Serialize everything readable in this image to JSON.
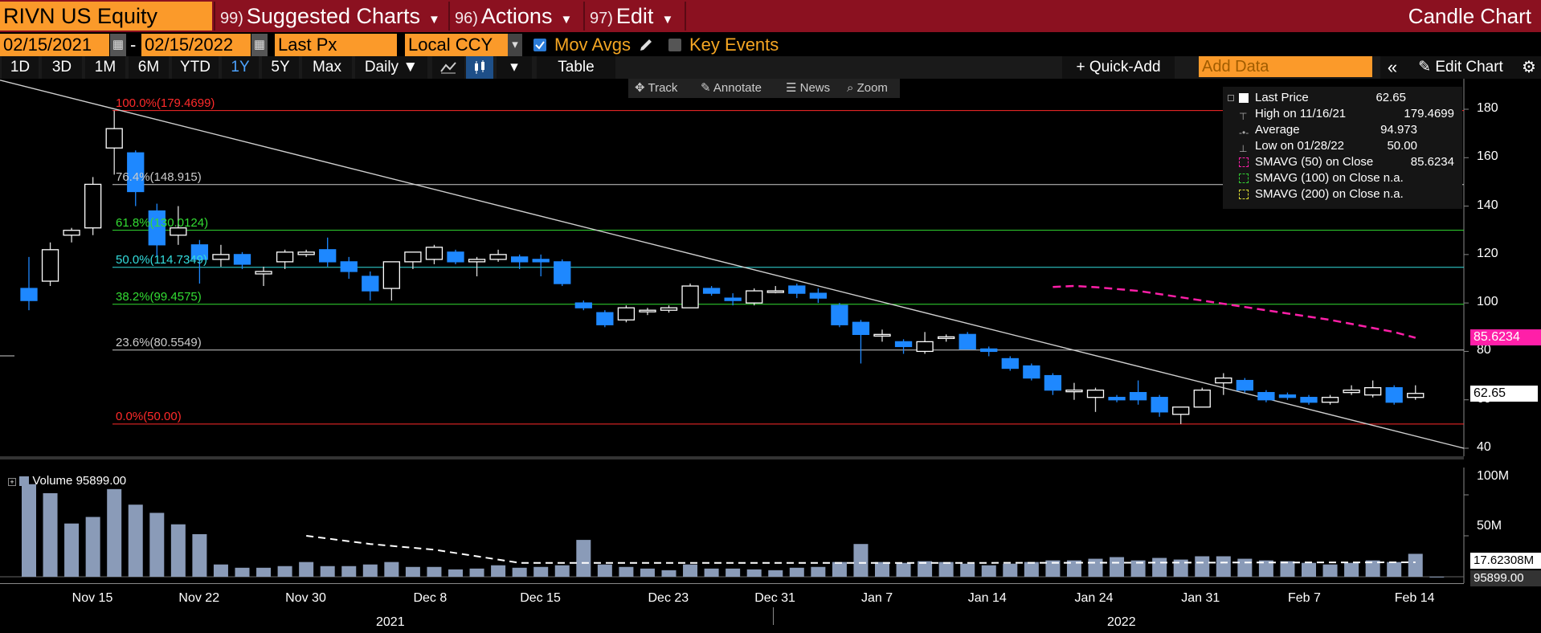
{
  "header": {
    "ticker": "RIVN US Equity",
    "menus": [
      {
        "num": "99)",
        "label": "Suggested Charts"
      },
      {
        "num": "96)",
        "label": "Actions"
      },
      {
        "num": "97)",
        "label": "Edit"
      }
    ],
    "title": "Candle Chart"
  },
  "params": {
    "start_date": "02/15/2021",
    "end_date": "02/15/2022",
    "dash": "-",
    "field": "Last Px",
    "currency": "Local CCY",
    "mov_avgs_label": "Mov Avgs",
    "key_events_label": "Key Events"
  },
  "toolbar": {
    "ranges": [
      "1D",
      "3D",
      "1M",
      "6M",
      "YTD",
      "1Y",
      "5Y",
      "Max"
    ],
    "active_range": "1Y",
    "frequency": "Daily",
    "table_label": "Table",
    "quick_add_label": "+ Quick-Add",
    "add_data_placeholder": "Add Data",
    "edit_chart_label": "Edit Chart"
  },
  "chart_tools": {
    "track": "Track",
    "annotate": "Annotate",
    "news": "News",
    "zoom": "Zoom"
  },
  "legend": {
    "last_price": {
      "label": "Last Price",
      "value": "62.65"
    },
    "high": {
      "label": "High on 11/16/21",
      "value": "179.4699"
    },
    "average": {
      "label": "Average",
      "value": "94.973"
    },
    "low": {
      "label": "Low on 01/28/22",
      "value": "50.00"
    },
    "sma50": {
      "label": "SMAVG (50)  on Close",
      "value": "85.6234"
    },
    "sma100": {
      "label": "SMAVG (100)  on Close n.a."
    },
    "sma200": {
      "label": "SMAVG (200)  on Close n.a."
    }
  },
  "fibonacci": [
    {
      "label": "100.0%(179.4699)",
      "price": 179.4699,
      "color": "#ff2a2a"
    },
    {
      "label": "76.4%(148.915)",
      "price": 148.915,
      "color": "#cccccc"
    },
    {
      "label": "61.8%(130.0124)",
      "price": 130.0124,
      "color": "#33dd33"
    },
    {
      "label": "50.0%(114.7349)",
      "price": 114.7349,
      "color": "#33dddd"
    },
    {
      "label": "38.2%(99.4575)",
      "price": 99.4575,
      "color": "#33dd33"
    },
    {
      "label": "23.6%(80.5549)",
      "price": 80.5549,
      "color": "#cccccc"
    },
    {
      "label": "0.0%(50.00)",
      "price": 50.0,
      "color": "#ff2a2a"
    }
  ],
  "price_axis": {
    "ticks": [
      "180",
      "160",
      "140",
      "120",
      "100",
      "80",
      "60",
      "40"
    ],
    "sma_tag": "85.6234",
    "last_tag": "62.65"
  },
  "volume": {
    "label": "Volume",
    "value": "95899.00",
    "ticks": [
      "100M",
      "50M"
    ],
    "avg_tag": "17.62308M",
    "last_tag": "95899.00"
  },
  "x_axis": {
    "labels": [
      "Nov 15",
      "Nov 22",
      "Nov 30",
      "Dec 8",
      "Dec 15",
      "Dec 23",
      "Dec 31",
      "Jan 7",
      "Jan 14",
      "Jan 24",
      "Jan 31",
      "Feb 7",
      "Feb 14"
    ],
    "years": [
      "2021",
      "2022"
    ]
  },
  "colors": {
    "header_bg": "#8b1120",
    "orange": "#fb9a2a",
    "down_candle": "#1e88ff",
    "up_candle": "#ffffff",
    "volume_bar": "#8a9bb8",
    "sma_line": "#ff1fa8"
  },
  "chart_data": {
    "type": "candlestick",
    "title": "",
    "ylim": [
      40,
      185
    ],
    "candles": [
      {
        "date": "2021-11-10",
        "o": 106,
        "h": 119,
        "l": 97,
        "c": 101
      },
      {
        "date": "2021-11-11",
        "o": 109,
        "h": 125,
        "l": 107,
        "c": 122
      },
      {
        "date": "2021-11-12",
        "o": 128,
        "h": 131,
        "l": 125,
        "c": 130
      },
      {
        "date": "2021-11-15",
        "o": 131,
        "h": 152,
        "l": 128,
        "c": 149
      },
      {
        "date": "2021-11-16",
        "o": 164,
        "h": 179.47,
        "l": 153,
        "c": 172
      },
      {
        "date": "2021-11-17",
        "o": 162,
        "h": 163,
        "l": 140,
        "c": 146
      },
      {
        "date": "2021-11-18",
        "o": 138,
        "h": 141,
        "l": 119,
        "c": 124
      },
      {
        "date": "2021-11-19",
        "o": 128,
        "h": 140,
        "l": 124,
        "c": 131
      },
      {
        "date": "2021-11-22",
        "o": 124,
        "h": 126,
        "l": 108,
        "c": 118
      },
      {
        "date": "2021-11-23",
        "o": 118,
        "h": 124,
        "l": 115,
        "c": 120
      },
      {
        "date": "2021-11-24",
        "o": 120,
        "h": 121,
        "l": 114,
        "c": 116
      },
      {
        "date": "2021-11-26",
        "o": 112,
        "h": 115,
        "l": 107,
        "c": 113
      },
      {
        "date": "2021-11-29",
        "o": 117,
        "h": 122,
        "l": 114,
        "c": 121
      },
      {
        "date": "2021-11-30",
        "o": 120,
        "h": 122,
        "l": 119,
        "c": 121
      },
      {
        "date": "2021-12-01",
        "o": 122,
        "h": 127,
        "l": 115,
        "c": 117
      },
      {
        "date": "2021-12-02",
        "o": 117,
        "h": 119,
        "l": 110,
        "c": 113
      },
      {
        "date": "2021-12-03",
        "o": 111,
        "h": 113,
        "l": 101,
        "c": 105
      },
      {
        "date": "2021-12-06",
        "o": 106,
        "h": 117,
        "l": 101,
        "c": 117
      },
      {
        "date": "2021-12-07",
        "o": 117,
        "h": 121,
        "l": 114,
        "c": 121
      },
      {
        "date": "2021-12-08",
        "o": 118,
        "h": 124,
        "l": 116,
        "c": 123
      },
      {
        "date": "2021-12-09",
        "o": 121,
        "h": 122,
        "l": 116,
        "c": 117
      },
      {
        "date": "2021-12-10",
        "o": 117,
        "h": 119,
        "l": 111,
        "c": 118
      },
      {
        "date": "2021-12-13",
        "o": 118,
        "h": 122,
        "l": 117,
        "c": 120
      },
      {
        "date": "2021-12-14",
        "o": 119,
        "h": 120,
        "l": 114,
        "c": 117
      },
      {
        "date": "2021-12-15",
        "o": 118,
        "h": 120,
        "l": 111,
        "c": 117
      },
      {
        "date": "2021-12-16",
        "o": 117,
        "h": 118,
        "l": 107,
        "c": 108
      },
      {
        "date": "2021-12-17",
        "o": 100,
        "h": 101,
        "l": 97,
        "c": 98
      },
      {
        "date": "2021-12-20",
        "o": 96,
        "h": 97,
        "l": 90,
        "c": 91
      },
      {
        "date": "2021-12-21",
        "o": 93,
        "h": 99,
        "l": 92,
        "c": 98
      },
      {
        "date": "2021-12-22",
        "o": 97,
        "h": 98,
        "l": 95,
        "c": 97
      },
      {
        "date": "2021-12-23",
        "o": 97,
        "h": 99,
        "l": 96,
        "c": 98
      },
      {
        "date": "2021-12-27",
        "o": 98,
        "h": 108,
        "l": 98,
        "c": 107
      },
      {
        "date": "2021-12-28",
        "o": 106,
        "h": 107,
        "l": 103,
        "c": 104
      },
      {
        "date": "2021-12-29",
        "o": 102,
        "h": 104,
        "l": 99,
        "c": 101
      },
      {
        "date": "2021-12-30",
        "o": 100,
        "h": 106,
        "l": 99,
        "c": 105
      },
      {
        "date": "2021-12-31",
        "o": 105,
        "h": 107,
        "l": 104,
        "c": 105
      },
      {
        "date": "2022-01-03",
        "o": 107,
        "h": 108,
        "l": 102,
        "c": 104
      },
      {
        "date": "2022-01-04",
        "o": 104,
        "h": 106,
        "l": 100,
        "c": 102
      },
      {
        "date": "2022-01-05",
        "o": 99,
        "h": 100,
        "l": 90,
        "c": 91
      },
      {
        "date": "2022-01-06",
        "o": 92,
        "h": 93,
        "l": 75,
        "c": 87
      },
      {
        "date": "2022-01-07",
        "o": 87,
        "h": 89,
        "l": 84,
        "c": 87
      },
      {
        "date": "2022-01-10",
        "o": 84,
        "h": 85,
        "l": 79,
        "c": 82
      },
      {
        "date": "2022-01-11",
        "o": 80,
        "h": 88,
        "l": 79,
        "c": 84
      },
      {
        "date": "2022-01-12",
        "o": 86,
        "h": 87,
        "l": 84,
        "c": 86
      },
      {
        "date": "2022-01-13",
        "o": 87,
        "h": 88,
        "l": 81,
        "c": 81
      },
      {
        "date": "2022-01-14",
        "o": 81,
        "h": 82,
        "l": 78,
        "c": 80
      },
      {
        "date": "2022-01-18",
        "o": 77,
        "h": 78,
        "l": 72,
        "c": 73
      },
      {
        "date": "2022-01-19",
        "o": 74,
        "h": 75,
        "l": 68,
        "c": 69
      },
      {
        "date": "2022-01-20",
        "o": 70,
        "h": 71,
        "l": 62,
        "c": 64
      },
      {
        "date": "2022-01-21",
        "o": 64,
        "h": 67,
        "l": 60,
        "c": 64
      },
      {
        "date": "2022-01-24",
        "o": 61,
        "h": 65,
        "l": 55,
        "c": 64
      },
      {
        "date": "2022-01-25",
        "o": 61,
        "h": 62,
        "l": 59,
        "c": 60
      },
      {
        "date": "2022-01-26",
        "o": 63,
        "h": 68,
        "l": 58,
        "c": 60
      },
      {
        "date": "2022-01-27",
        "o": 61,
        "h": 62,
        "l": 53,
        "c": 55
      },
      {
        "date": "2022-01-28",
        "o": 54,
        "h": 57,
        "l": 50,
        "c": 57
      },
      {
        "date": "2022-01-31",
        "o": 57,
        "h": 65,
        "l": 57,
        "c": 64
      },
      {
        "date": "2022-02-01",
        "o": 67,
        "h": 71,
        "l": 62,
        "c": 69
      },
      {
        "date": "2022-02-02",
        "o": 68,
        "h": 69,
        "l": 63,
        "c": 64
      },
      {
        "date": "2022-02-03",
        "o": 63,
        "h": 64,
        "l": 59,
        "c": 60
      },
      {
        "date": "2022-02-04",
        "o": 62,
        "h": 63,
        "l": 60,
        "c": 61
      },
      {
        "date": "2022-02-07",
        "o": 61,
        "h": 62,
        "l": 58,
        "c": 59
      },
      {
        "date": "2022-02-08",
        "o": 59,
        "h": 62,
        "l": 58,
        "c": 61
      },
      {
        "date": "2022-02-09",
        "o": 63,
        "h": 66,
        "l": 62,
        "c": 64
      },
      {
        "date": "2022-02-10",
        "o": 62,
        "h": 68,
        "l": 61,
        "c": 65
      },
      {
        "date": "2022-02-11",
        "o": 65,
        "h": 66,
        "l": 58,
        "c": 59
      },
      {
        "date": "2022-02-14",
        "o": 61,
        "h": 66,
        "l": 60,
        "c": 62.65
      }
    ],
    "sma50": [
      {
        "date": "2022-01-20",
        "v": 106.6
      },
      {
        "date": "2022-01-21",
        "v": 107.0
      },
      {
        "date": "2022-01-24",
        "v": 106.5
      },
      {
        "date": "2022-01-26",
        "v": 105.0
      },
      {
        "date": "2022-01-31",
        "v": 101.0
      },
      {
        "date": "2022-02-03",
        "v": 97.0
      },
      {
        "date": "2022-02-08",
        "v": 93.0
      },
      {
        "date": "2022-02-11",
        "v": 88.0
      },
      {
        "date": "2022-02-14",
        "v": 85.6234
      }
    ],
    "volume_millions": [
      113,
      102,
      65,
      73,
      107,
      88,
      78,
      64,
      52,
      15,
      11,
      11,
      13,
      18,
      13,
      13,
      15,
      18,
      12,
      12,
      9,
      10,
      14,
      11,
      12,
      14,
      45,
      15,
      12,
      10,
      8,
      15,
      10,
      10,
      9,
      8,
      11,
      12,
      18,
      40,
      18,
      17,
      19,
      18,
      16,
      14,
      16,
      18,
      20,
      20,
      22,
      24,
      20,
      23,
      21,
      25,
      25,
      22,
      20,
      19,
      17,
      15,
      17,
      20,
      18,
      28,
      0.096
    ],
    "volume_avg_millions": [
      {
        "date": "2021-11-30",
        "v": 50
      },
      {
        "date": "2021-12-03",
        "v": 40
      },
      {
        "date": "2021-12-08",
        "v": 33
      },
      {
        "date": "2021-12-14",
        "v": 17
      },
      {
        "date": "2022-01-14",
        "v": 17
      },
      {
        "date": "2022-02-14",
        "v": 17.62308
      }
    ],
    "trendline": [
      {
        "date": "2021-11-08",
        "v": 192
      },
      {
        "date": "2022-02-16",
        "v": 40
      }
    ]
  }
}
